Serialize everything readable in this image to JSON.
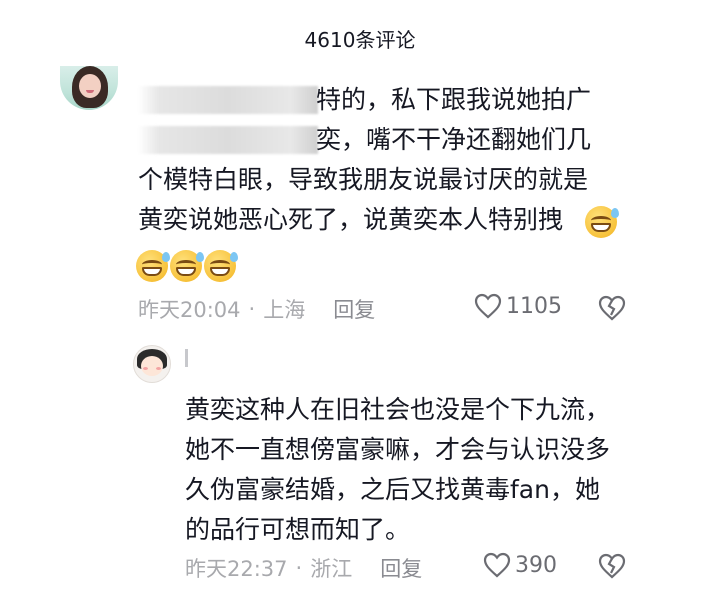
{
  "header": {
    "title": "4610条评论"
  },
  "comments": [
    {
      "lines": [
        "特的，私下跟我说她拍广",
        "奕，嘴不干净还翻她们几",
        "个模特白眼，导致我朋友说最讨厌的就是",
        "黄奕说她恶心死了，说黄奕本人特别拽"
      ],
      "emoji_name": "grinning-sweat-emoji",
      "time": "昨天20:04",
      "location": "上海",
      "reply_label": "回复",
      "likes": "1105"
    },
    {
      "lines": [
        "黄奕这种人在旧社会也没是个下九流，",
        "她不一直想傍富豪嘛，才会与认识没多",
        "久伪富豪结婚，之后又找黄毒fan，她",
        "的品行可想而知了。"
      ],
      "time": "昨天22:37",
      "location": "浙江",
      "reply_label": "回复",
      "likes": "390"
    }
  ],
  "separator": "·",
  "colors": {
    "text": "#161823",
    "meta": "#a8a9ad",
    "icon": "#6b6c72"
  }
}
